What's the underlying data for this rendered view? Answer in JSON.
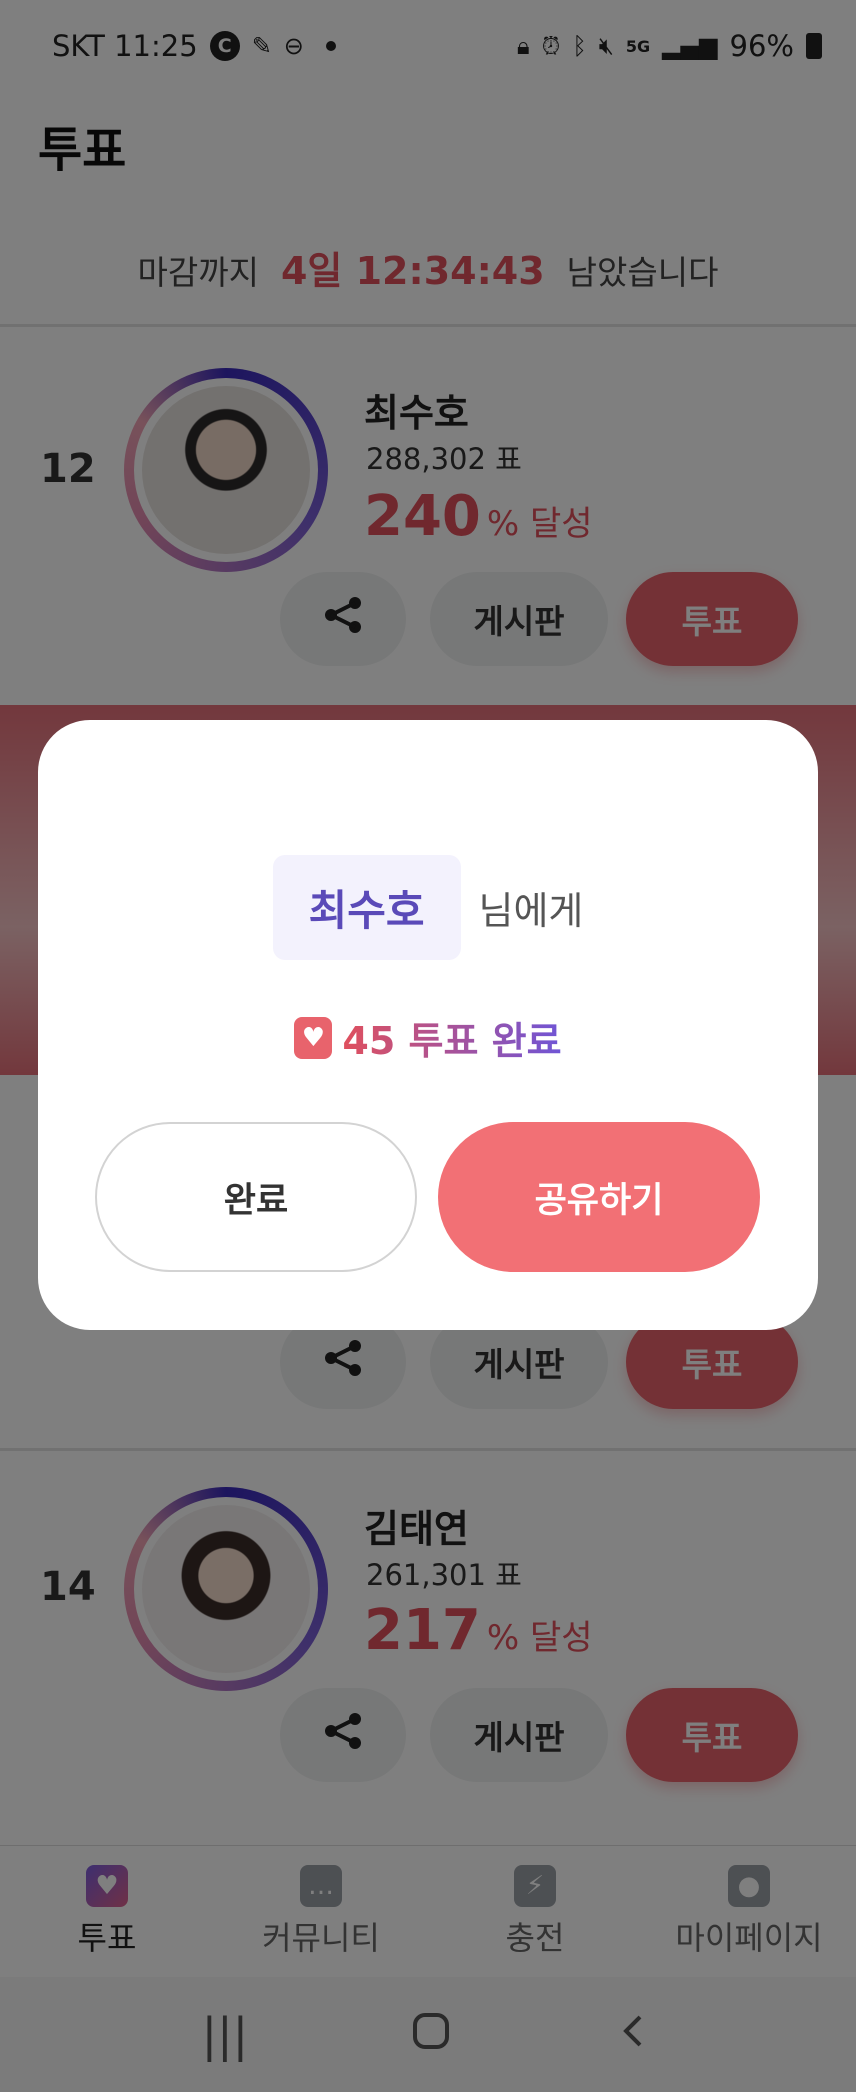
{
  "status_bar": {
    "carrier_time": "SKT 11:25",
    "battery": "96%"
  },
  "header": {
    "title": "투표"
  },
  "countdown": {
    "prefix": "마감까지",
    "time": "4일 12:34:43",
    "suffix": "남았습니다"
  },
  "cards": [
    {
      "rank": "12",
      "name": "최수호",
      "votes": "288,302 표",
      "percent": "240",
      "percent_suffix": "% 달성",
      "board_label": "게시판",
      "vote_label": "투표"
    },
    {
      "board_label": "게시판",
      "vote_label": "투표"
    },
    {
      "rank": "14",
      "name": "김태연",
      "votes": "261,301 표",
      "percent": "217",
      "percent_suffix": "% 달성",
      "board_label": "게시판",
      "vote_label": "투표"
    }
  ],
  "dialog": {
    "recipient_name": "최수호",
    "recipient_suffix": "님에게",
    "vote_count_text": "45 투표 완료",
    "complete_label": "완료",
    "share_label": "공유하기"
  },
  "bottom_nav": [
    {
      "label": "투표",
      "icon": "heart-vote-icon",
      "active": true
    },
    {
      "label": "커뮤니티",
      "icon": "chat-bubbles-icon",
      "active": false
    },
    {
      "label": "충전",
      "icon": "charge-icon",
      "active": false
    },
    {
      "label": "마이페이지",
      "icon": "person-icon",
      "active": false
    }
  ],
  "colors": {
    "accent": "#e8636c",
    "purple": "#5a4ab8"
  }
}
